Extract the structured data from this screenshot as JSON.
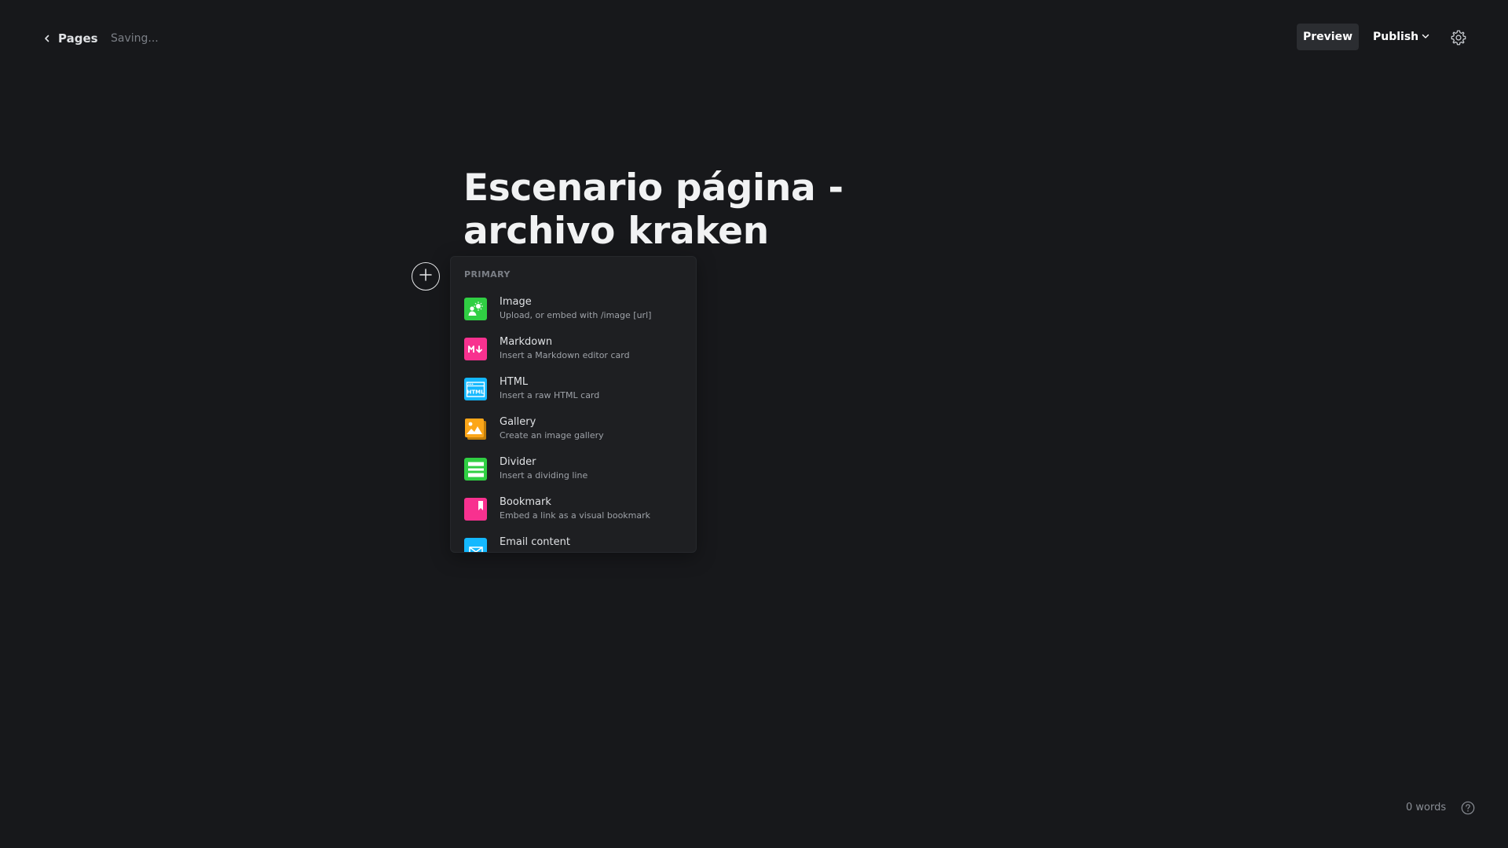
{
  "topbar": {
    "back_label": "Pages",
    "status": "Saving...",
    "preview_label": "Preview",
    "publish_label": "Publish"
  },
  "editor": {
    "title": "Escenario página - archivo kraken"
  },
  "card_menu": {
    "section_label": "PRIMARY",
    "items": [
      {
        "label": "Image",
        "description": "Upload, or embed with /image [url]",
        "icon": "image-icon",
        "color": "#30cf43"
      },
      {
        "label": "Markdown",
        "description": "Insert a Markdown editor card",
        "icon": "markdown-icon",
        "color": "#f8318f"
      },
      {
        "label": "HTML",
        "description": "Insert a raw HTML card",
        "icon": "html-icon",
        "color": "#14b8ff"
      },
      {
        "label": "Gallery",
        "description": "Create an image gallery",
        "icon": "gallery-icon",
        "color": "#fca619"
      },
      {
        "label": "Divider",
        "description": "Insert a dividing line",
        "icon": "divider-icon",
        "color": "#30cf43"
      },
      {
        "label": "Bookmark",
        "description": "Embed a link as a visual bookmark",
        "icon": "bookmark-icon",
        "color": "#f8318f"
      },
      {
        "label": "Email content",
        "description": "",
        "icon": "email-icon",
        "color": "#14b8ff"
      }
    ]
  },
  "footer": {
    "word_count": "0 words"
  }
}
